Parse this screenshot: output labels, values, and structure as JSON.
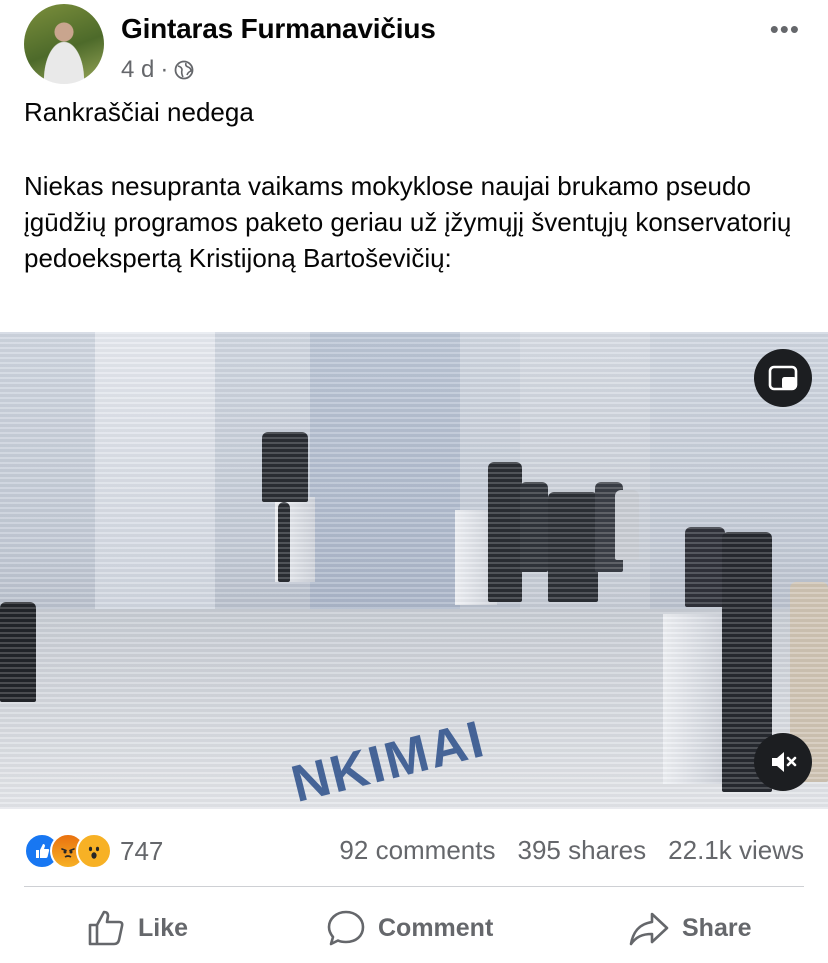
{
  "post": {
    "author": "Gintaras Furmanavičius",
    "time": "4 d",
    "separator": "·",
    "privacy_icon": "globe-icon",
    "more_icon": "more-options-icon",
    "more_label": "•••",
    "title": "Rankraščiai nedega",
    "body": "Niekas nesupranta vaikams mokyklose naujai brukamo pseudo įgūdžių programos paketo geriau už  įžymųjį šventųjų konservatorių pedoekspertą Kristijoną Bartoševičių:"
  },
  "video": {
    "floor_text": "NKIMAI",
    "pip_icon": "picture-in-picture-icon",
    "mute_icon": "muted-speaker-icon"
  },
  "stats": {
    "reactions": [
      "like",
      "angry",
      "wow"
    ],
    "reaction_count": "747",
    "comments": "92 comments",
    "shares": "395 shares",
    "views": "22.1k views"
  },
  "actions": {
    "like": "Like",
    "comment": "Comment",
    "share": "Share"
  },
  "colors": {
    "accent": "#1877f2",
    "secondary_text": "#65676b"
  }
}
